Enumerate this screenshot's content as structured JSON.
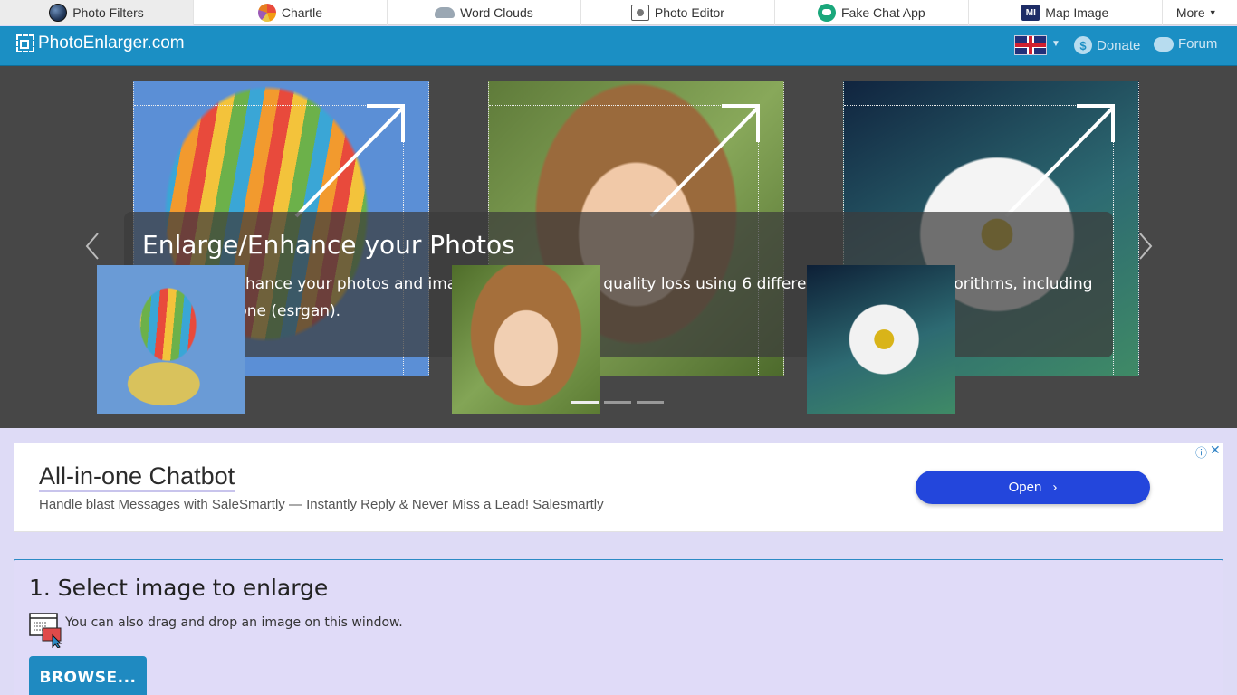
{
  "topbar": {
    "tabs": [
      {
        "label": "Photo Filters",
        "icon": "globe-icon",
        "active": true
      },
      {
        "label": "Chartle",
        "icon": "chartle-icon"
      },
      {
        "label": "Word Clouds",
        "icon": "cloud-icon"
      },
      {
        "label": "Photo Editor",
        "icon": "photo-editor-icon"
      },
      {
        "label": "Fake Chat App",
        "icon": "chat-app-icon"
      },
      {
        "label": "Map Image",
        "icon": "map-image-icon",
        "icon_text": "MI"
      }
    ],
    "more_label": "More"
  },
  "header": {
    "site_name": "PhotoEnlarger.com",
    "donate_label": "Donate",
    "forum_label": "Forum",
    "accent_color": "#1b8fc4",
    "donate_icon_text": "$"
  },
  "carousel": {
    "title": "Enlarge/Enhance your Photos",
    "description": "Enlarge or enhance your photos and images online without quality loss using 6 different enlargement algorithms, including an AI based one (esrgan).",
    "indicator_count": 3,
    "active_indicator": 0
  },
  "ad": {
    "title": "All-in-one Chatbot",
    "text": "Handle blast Messages with SaleSmartly — Instantly Reply & Never Miss a Lead! Salesmartly",
    "button_label": "Open",
    "button_color": "#2346dc"
  },
  "select_panel": {
    "heading": "1. Select image to enlarge",
    "drag_drop_text": "You can also drag and drop an image on this window.",
    "browse_label": "BROWSE..."
  }
}
